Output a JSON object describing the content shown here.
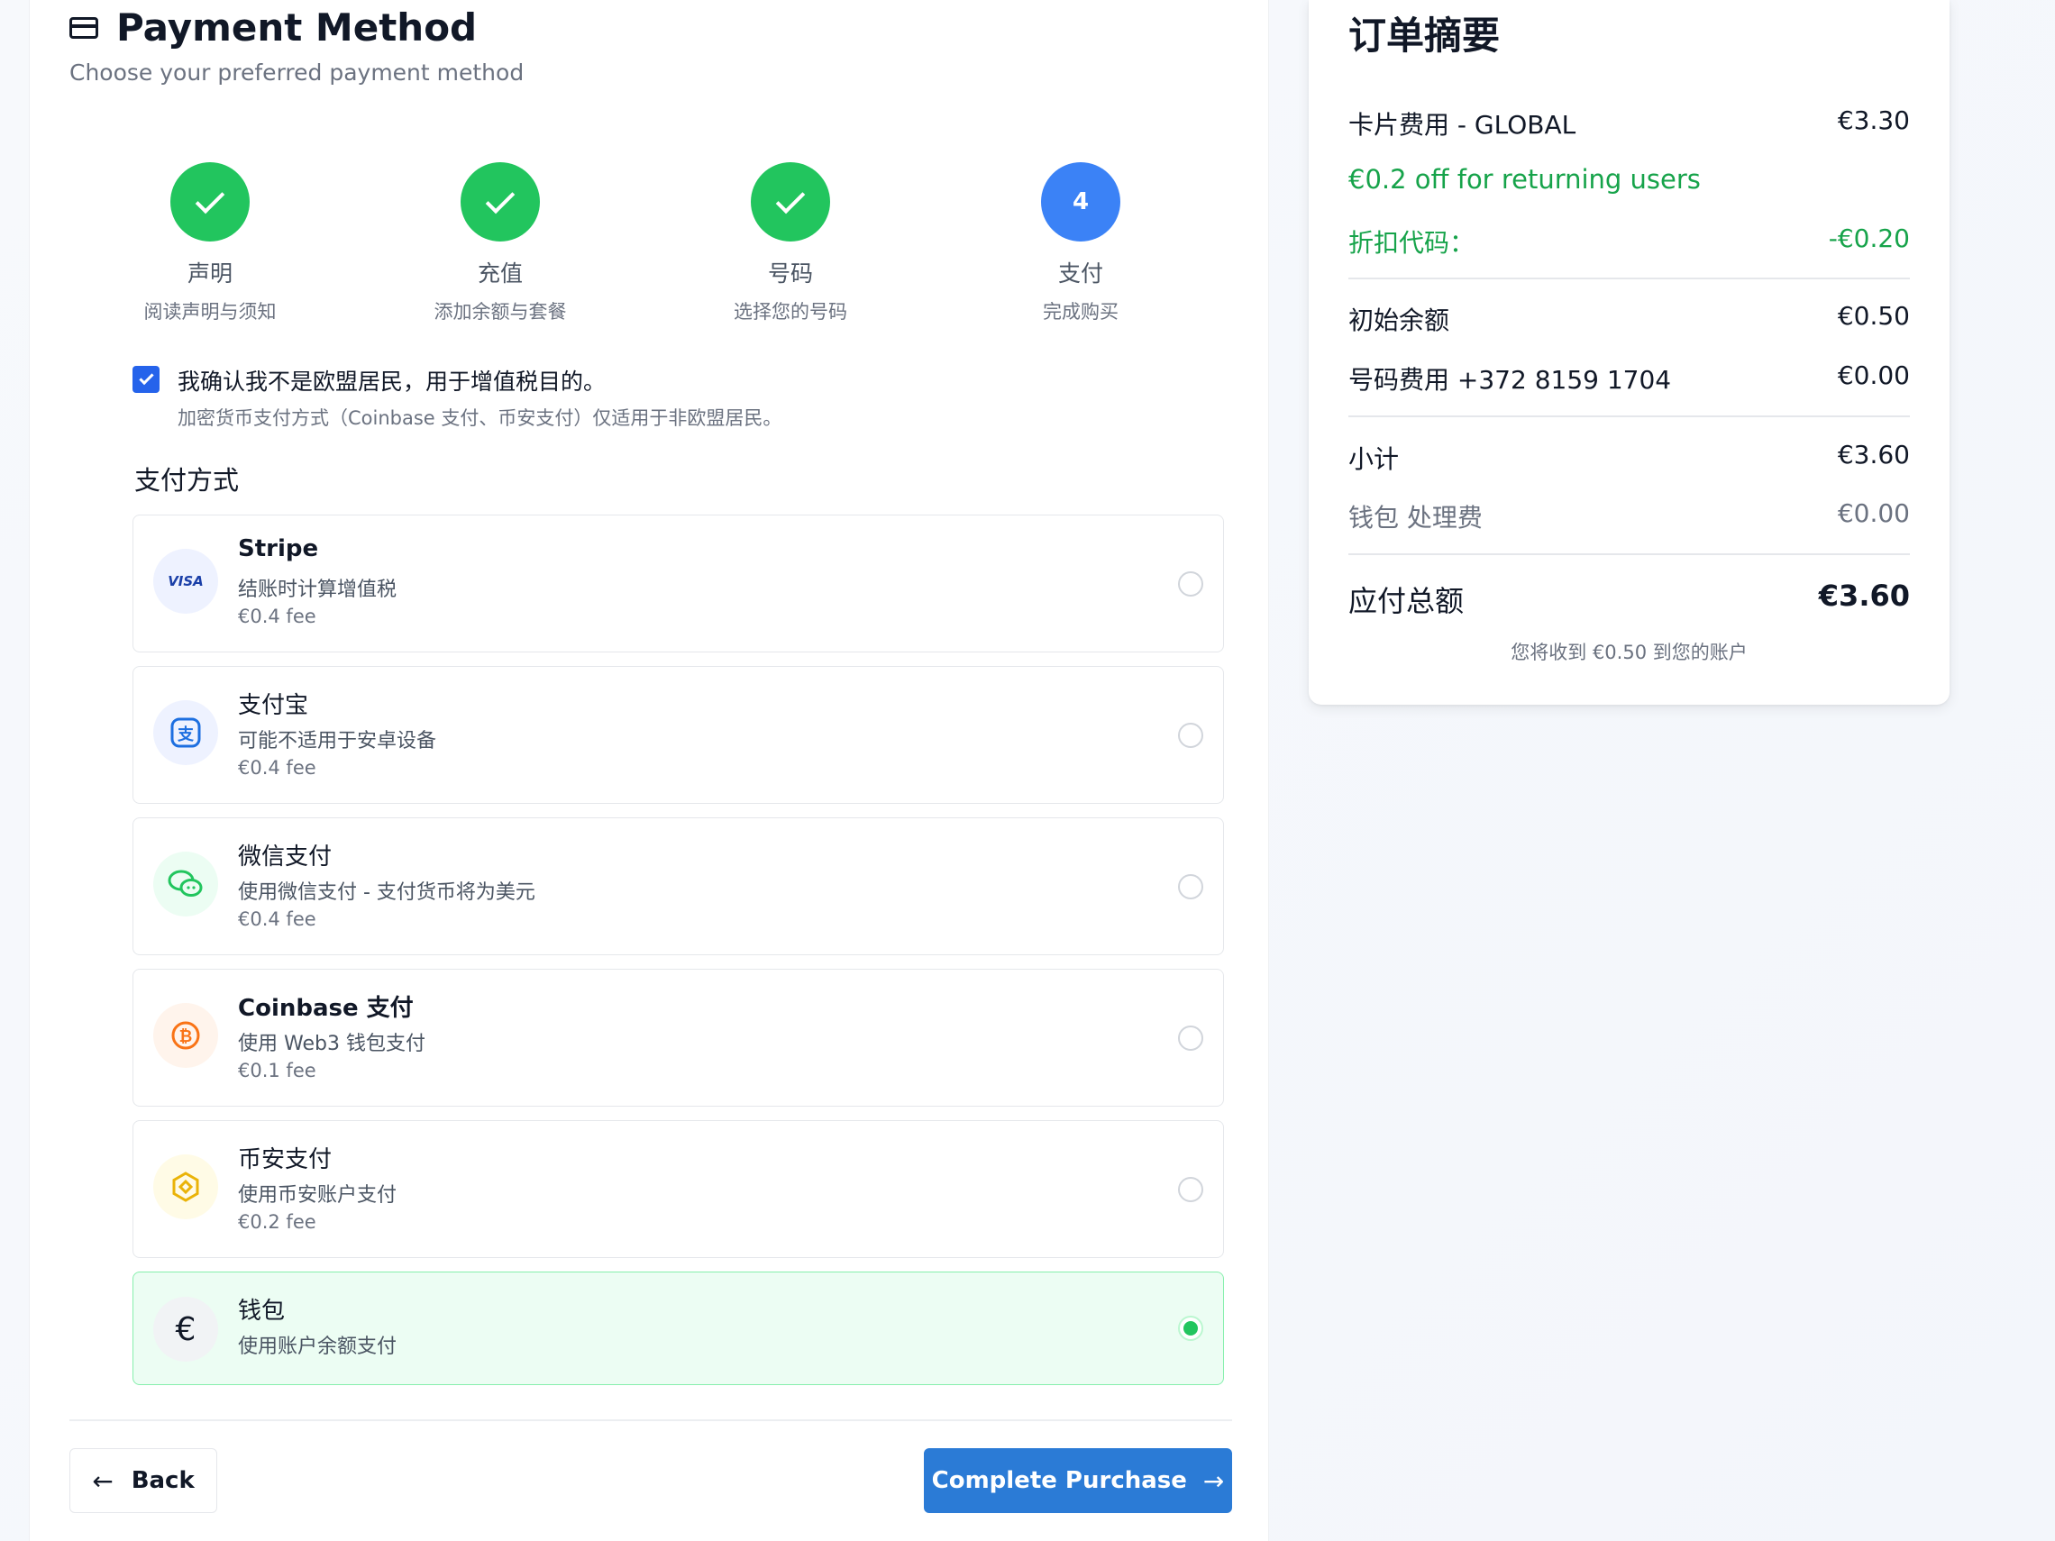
{
  "header": {
    "title": "Payment Method",
    "subtitle": "Choose your preferred payment method"
  },
  "steps": [
    {
      "title": "声明",
      "desc": "阅读声明与须知",
      "status": "done"
    },
    {
      "title": "充值",
      "desc": "添加余额与套餐",
      "status": "done"
    },
    {
      "title": "号码",
      "desc": "选择您的号码",
      "status": "done"
    },
    {
      "title": "支付",
      "desc": "完成购买",
      "status": "active",
      "number": "4"
    }
  ],
  "confirm": {
    "checked": true,
    "text": "我确认我不是欧盟居民，用于增值税目的。",
    "note": "加密货币支付方式（Coinbase 支付、币安支付）仅适用于非欧盟居民。"
  },
  "payment_section_label": "支付方式",
  "methods": [
    {
      "title": "Stripe",
      "desc": "结账时计算增值税",
      "fee": "€0.4 fee",
      "icon": "visa-icon",
      "selected": false
    },
    {
      "title": "支付宝",
      "desc": "可能不适用于安卓设备",
      "fee": "€0.4 fee",
      "icon": "alipay-icon",
      "selected": false
    },
    {
      "title": "微信支付",
      "desc": "使用微信支付 - 支付货币将为美元",
      "fee": "€0.4 fee",
      "icon": "wechat-icon",
      "selected": false
    },
    {
      "title": "Coinbase 支付",
      "desc": "使用 Web3 钱包支付",
      "fee": "€0.1 fee",
      "icon": "coinbase-icon",
      "selected": false
    },
    {
      "title": "币安支付",
      "desc": "使用币安账户支付",
      "fee": "€0.2 fee",
      "icon": "binance-icon",
      "selected": false
    },
    {
      "title": "钱包",
      "desc": "使用账户余额支付",
      "icon": "euro-icon",
      "selected": true
    }
  ],
  "buttons": {
    "back": "Back",
    "complete": "Complete Purchase"
  },
  "summary": {
    "title": "订单摘要",
    "card_fee_label": "卡片费用 - GLOBAL",
    "card_fee_value": "€3.30",
    "promo": "€0.2 off for returning users",
    "discount_label": "折扣代码：",
    "discount_value": "-€0.20",
    "initial_balance_label": "初始余额",
    "initial_balance_value": "€0.50",
    "number_fee_label": "号码费用 +372 8159 1704",
    "number_fee_value": "€0.00",
    "subtotal_label": "小计",
    "subtotal_value": "€3.60",
    "wallet_fee_label": "钱包 处理费",
    "wallet_fee_value": "€0.00",
    "total_label": "应付总额",
    "total_value": "€3.60",
    "note": "您将收到 €0.50 到您的账户"
  },
  "colors": {
    "accent_blue": "#2b7bd6",
    "step_done": "#22c55e",
    "step_active": "#3b82f6",
    "discount_green": "#16a34a"
  }
}
